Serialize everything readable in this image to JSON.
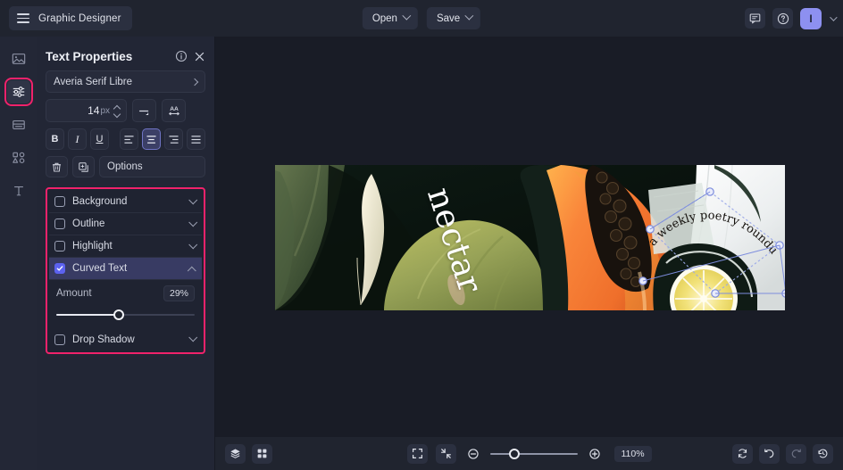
{
  "topbar": {
    "menu_icon": "hamburger-icon",
    "app_title": "Graphic Designer",
    "open_label": "Open",
    "save_label": "Save",
    "comment_icon": "comment-icon",
    "help_icon": "help-circle-icon",
    "avatar_initial": "I"
  },
  "rail": {
    "items": [
      {
        "name": "image-tool",
        "icon": "image-icon",
        "active": false
      },
      {
        "name": "adjustments-tool",
        "icon": "sliders-icon",
        "active": true
      },
      {
        "name": "layout-tool",
        "icon": "card-layout-icon",
        "active": false
      },
      {
        "name": "shapes-tool",
        "icon": "shapes-icon",
        "active": false
      },
      {
        "name": "text-tool",
        "icon": "text-t-icon",
        "active": false
      }
    ]
  },
  "panel": {
    "title": "Text Properties",
    "info_icon": "info-circle-icon",
    "close_icon": "close-x-icon",
    "font_family": "Averia Serif Libre",
    "font_size_value": "14",
    "font_size_unit": "px",
    "line_height_icon": "line-height-icon",
    "letter_spacing_icon": "letter-spacing-aa-icon",
    "bold_label": "B",
    "italic_label": "I",
    "underline_label": "U",
    "align_left_icon": "align-left-icon",
    "align_center_icon": "align-center-icon",
    "align_right_icon": "align-right-icon",
    "align_justify_icon": "align-justify-icon",
    "selected_align": "center",
    "delete_icon": "trash-icon",
    "duplicate_icon": "duplicate-icon",
    "options_label": "Options",
    "accordion": [
      {
        "label": "Background",
        "checked": false,
        "open": false
      },
      {
        "label": "Outline",
        "checked": false,
        "open": false
      },
      {
        "label": "Highlight",
        "checked": false,
        "open": false
      },
      {
        "label": "Curved Text",
        "checked": true,
        "open": true
      },
      {
        "label": "Drop Shadow",
        "checked": false,
        "open": false
      }
    ],
    "curved_text": {
      "amount_label": "Amount",
      "amount_value": "29%",
      "amount_percent": 45
    },
    "highlight_color": "#f0226b",
    "accent_color": "#5c62ef"
  },
  "canvas": {
    "headline_text": "nectar",
    "curved_text": "a weekly poetry roundup",
    "selection_handles": 8
  },
  "bottombar": {
    "layers_icon": "layers-icon",
    "grid_icon": "grid-icon",
    "fit_screen_icon": "fit-screen-icon",
    "collapse_icon": "collapse-arrows-icon",
    "zoom_out_icon": "zoom-out-icon",
    "zoom_in_icon": "zoom-in-icon",
    "zoom_level": "110%",
    "zoom_slider_percent": 28,
    "reset_icon": "reset-sync-icon",
    "undo_icon": "undo-icon",
    "redo_icon": "redo-icon",
    "history_icon": "history-clock-icon"
  }
}
